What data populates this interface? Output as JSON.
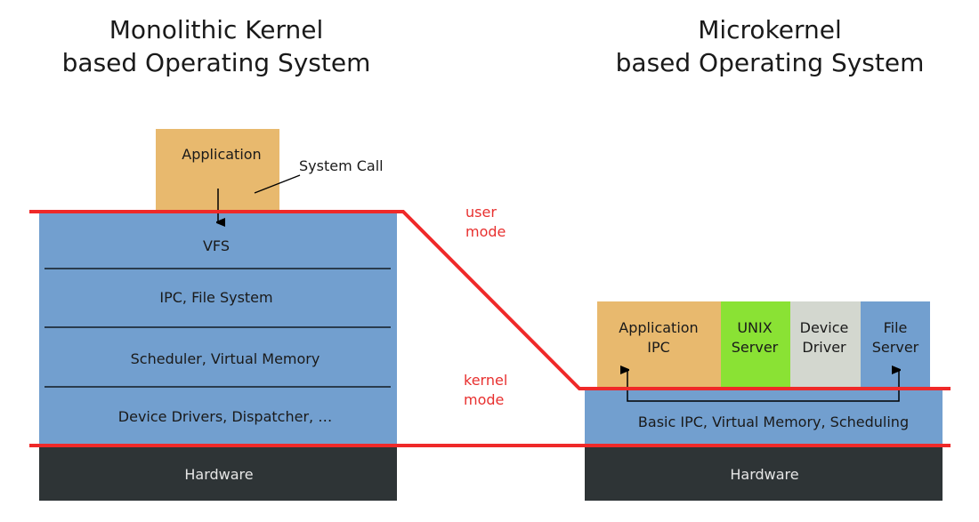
{
  "colors": {
    "application": "#e8b96e",
    "kernel": "#729fcf",
    "unix_server": "#8ae234",
    "device_driver": "#d3d7cf",
    "file_server": "#729fcf",
    "hardware": "#2e3436",
    "mode_line": "#ef2929",
    "mode_text": "#e8302f"
  },
  "monolithic": {
    "title_line1": "Monolithic Kernel",
    "title_line2": "based Operating System",
    "application": "Application",
    "system_call": "System Call",
    "layers": [
      "VFS",
      "IPC, File System",
      "Scheduler, Virtual Memory",
      "Device Drivers, Dispatcher, …"
    ],
    "hardware": "Hardware"
  },
  "modes": {
    "user_line1": "user",
    "user_line2": "mode",
    "kernel_line1": "kernel",
    "kernel_line2": "mode"
  },
  "microkernel": {
    "title_line1": "Microkernel",
    "title_line2": "based Operating System",
    "servers": [
      {
        "line1": "Application",
        "line2": "IPC"
      },
      {
        "line1": "UNIX",
        "line2": "Server"
      },
      {
        "line1": "Device",
        "line2": "Driver"
      },
      {
        "line1": "File",
        "line2": "Server"
      }
    ],
    "kernel": "Basic IPC, Virtual Memory, Scheduling",
    "hardware": "Hardware"
  }
}
